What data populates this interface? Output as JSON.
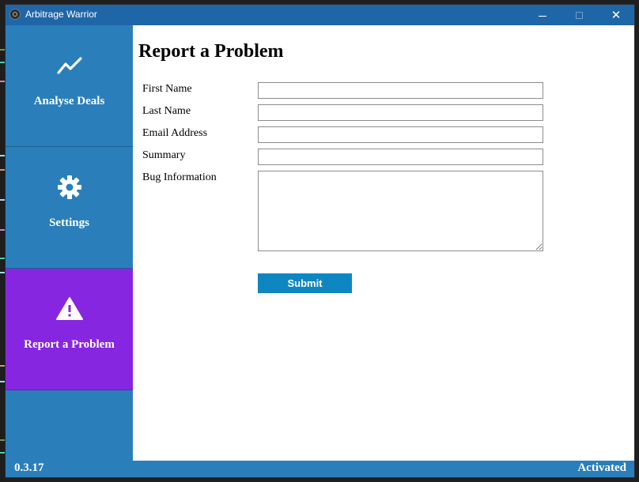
{
  "window": {
    "title": "Arbitrage Warrior",
    "logo_icon": "app-logo-icon",
    "controls": {
      "minimize_icon": "minimize-icon",
      "maximize_icon": "maximize-icon",
      "close_glyph": "✕"
    }
  },
  "sidebar": {
    "items": [
      {
        "label": "Analyse Deals",
        "icon": "trend-chart-icon",
        "active": false
      },
      {
        "label": "Settings",
        "icon": "gear-icon",
        "active": false
      },
      {
        "label": "Report a Problem",
        "icon": "warning-icon",
        "active": true
      }
    ]
  },
  "main": {
    "title": "Report a Problem",
    "form": {
      "fields": [
        {
          "label": "First Name",
          "value": "",
          "placeholder": ""
        },
        {
          "label": "Last Name",
          "value": "",
          "placeholder": ""
        },
        {
          "label": "Email Address",
          "value": "",
          "placeholder": ""
        },
        {
          "label": "Summary",
          "value": "",
          "placeholder": ""
        },
        {
          "label": "Bug Information",
          "value": "",
          "placeholder": ""
        }
      ],
      "submit_label": "Submit"
    }
  },
  "statusbar": {
    "version": "0.3.17",
    "status": "Activated"
  },
  "colors": {
    "titlebar": "#1f66a8",
    "sidebar": "#2a7fba",
    "active_item": "#8726e0",
    "submit": "#0e86c2"
  }
}
